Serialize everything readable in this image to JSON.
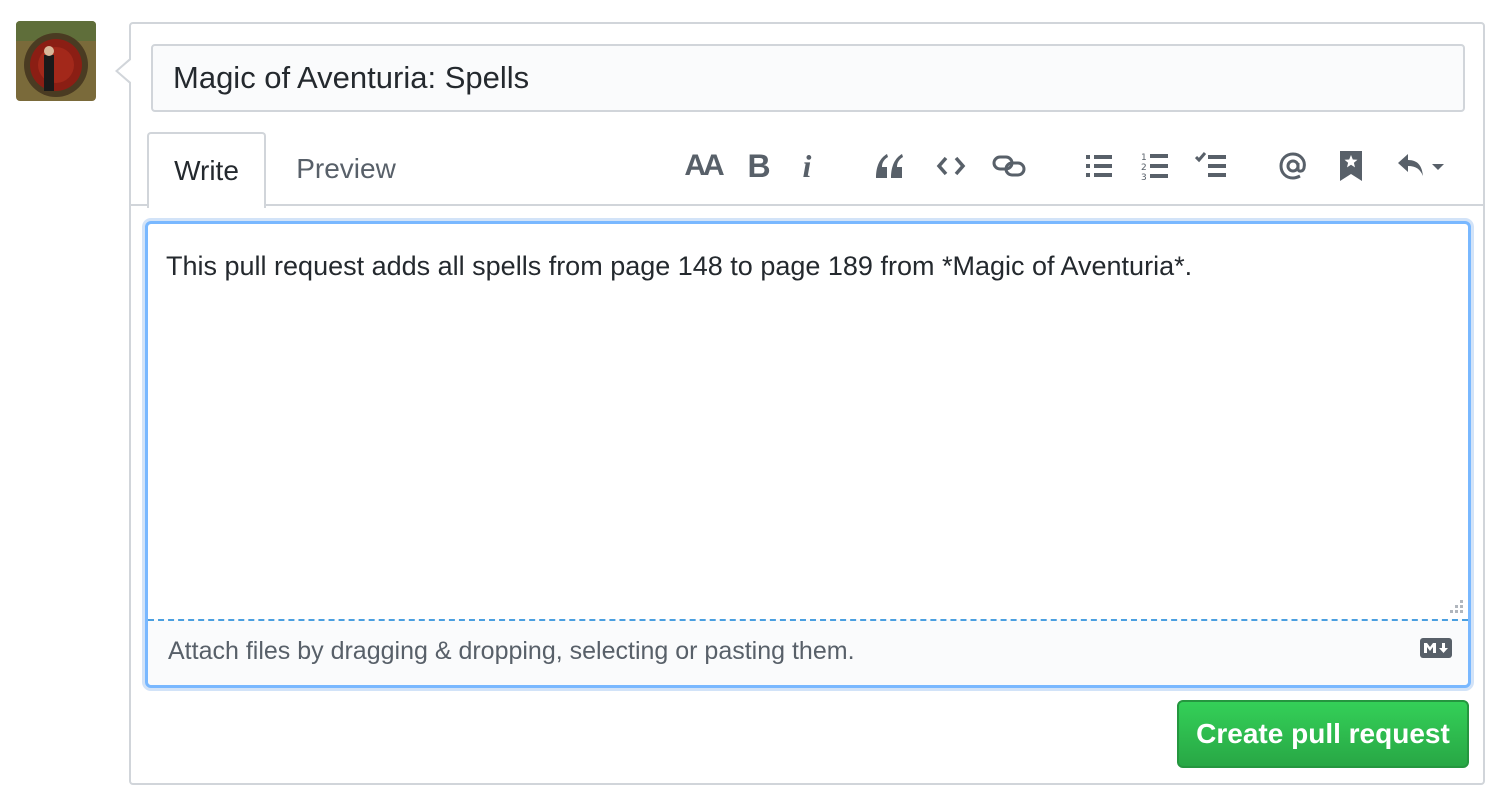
{
  "pr_title": "Magic of Aventuria: Spells",
  "tabs": {
    "write": "Write",
    "preview": "Preview"
  },
  "toolbar": {
    "heading_label": "AA",
    "bold_label": "B",
    "italic_label": "i",
    "icons": [
      "text-size-icon",
      "bold-icon",
      "italic-icon",
      "quote-icon",
      "code-icon",
      "link-icon",
      "unordered-list-icon",
      "ordered-list-icon",
      "task-list-icon",
      "mention-icon",
      "reference-icon",
      "saved-reply-icon"
    ]
  },
  "body": "This pull request adds all spells from page 148 to page 189 from *Magic of Aventuria*.",
  "attach_hint": "Attach files by dragging & dropping, selecting or pasting them.",
  "markdown_badge": "M↓",
  "submit_label": "Create pull request",
  "colors": {
    "accent": "#0366d6",
    "submit": "#2ea44f",
    "border": "#d1d5da",
    "muted": "#586069"
  }
}
